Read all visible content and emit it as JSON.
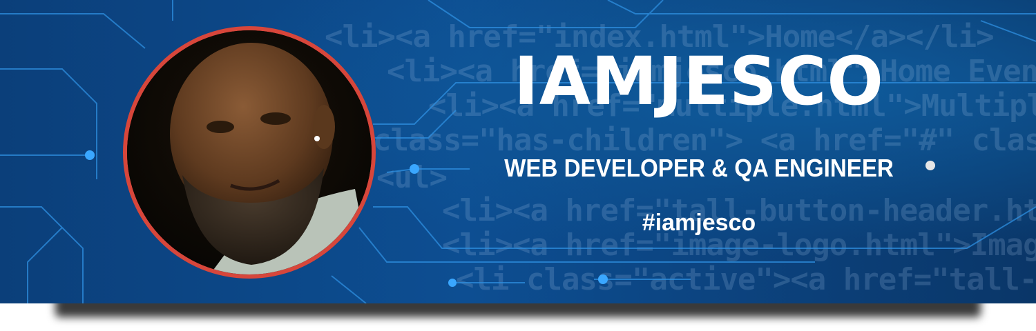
{
  "banner": {
    "name": "IAMJESCO",
    "tagline": "WEB DEVELOPER & QA ENGINEER",
    "hashtag": "#iamjesco"
  },
  "background_code": [
    "<li><a href=\"index.html\">Home</a></li>",
    "<li><a href=\"iamjesco.html\">Home Events</a></li>",
    "<li><a href=\"multiple.html\">Multiple Column Menu",
    "class=\"has-children\"> <a href=\"#\" class=\"current",
    "<ul>",
    "<li><a href=\"tall-button-header.html\">Tall Button",
    "<li><a href=\"image-logo.html\">Image Logo</a>",
    "<li class=\"active\"><a href=\"tall-logo.html\">"
  ],
  "colors": {
    "background": "#0d4e92",
    "avatar_ring": "#d7463b",
    "circuit": "#2e8fe0",
    "text": "#ffffff"
  },
  "avatar": {
    "icon": "profile-photo"
  }
}
